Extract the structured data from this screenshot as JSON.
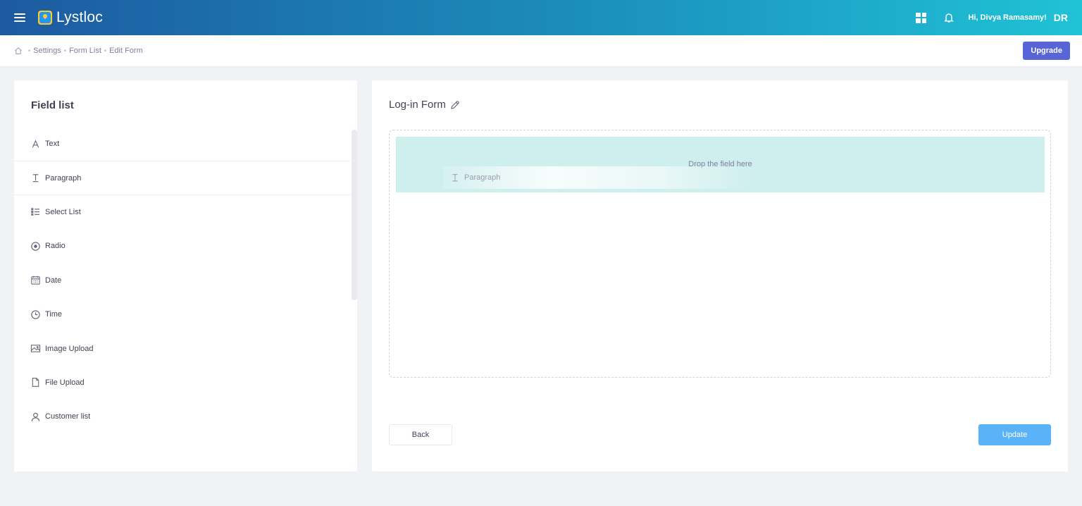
{
  "topbar": {
    "brand": "Lystloc",
    "greeting": "Hi, Divya Ramasamy!",
    "initials": "DR",
    "icons": [
      "menu-icon",
      "logo-icon",
      "apps-grid-icon",
      "bell-icon"
    ]
  },
  "breadcrumb": {
    "home_icon": "home-icon",
    "items": [
      "Settings",
      "Form List",
      "Edit Form"
    ],
    "separator": "•",
    "upgrade_label": "Upgrade"
  },
  "field_panel": {
    "title": "Field list",
    "items": [
      {
        "label": "Text",
        "icon": "text-icon"
      },
      {
        "label": "Paragraph",
        "icon": "paragraph-icon"
      },
      {
        "label": "Select List",
        "icon": "list-icon"
      },
      {
        "label": "Radio",
        "icon": "radio-icon"
      },
      {
        "label": "Date",
        "icon": "calendar-icon"
      },
      {
        "label": "Time",
        "icon": "clock-icon"
      },
      {
        "label": "Image Upload",
        "icon": "image-icon"
      },
      {
        "label": "File Upload",
        "icon": "file-icon"
      },
      {
        "label": "Customer list",
        "icon": "user-icon"
      }
    ]
  },
  "form": {
    "title": "Log-in Form",
    "drop_placeholder": "Drop the field here",
    "dragging_item": "Paragraph",
    "back_label": "Back",
    "update_label": "Update"
  },
  "colors": {
    "accent": "#5865d8",
    "update": "#5ab2f7",
    "drop_target": "#cfeeee",
    "topbar_start": "#1d5aa0",
    "topbar_end": "#20c2d6"
  }
}
